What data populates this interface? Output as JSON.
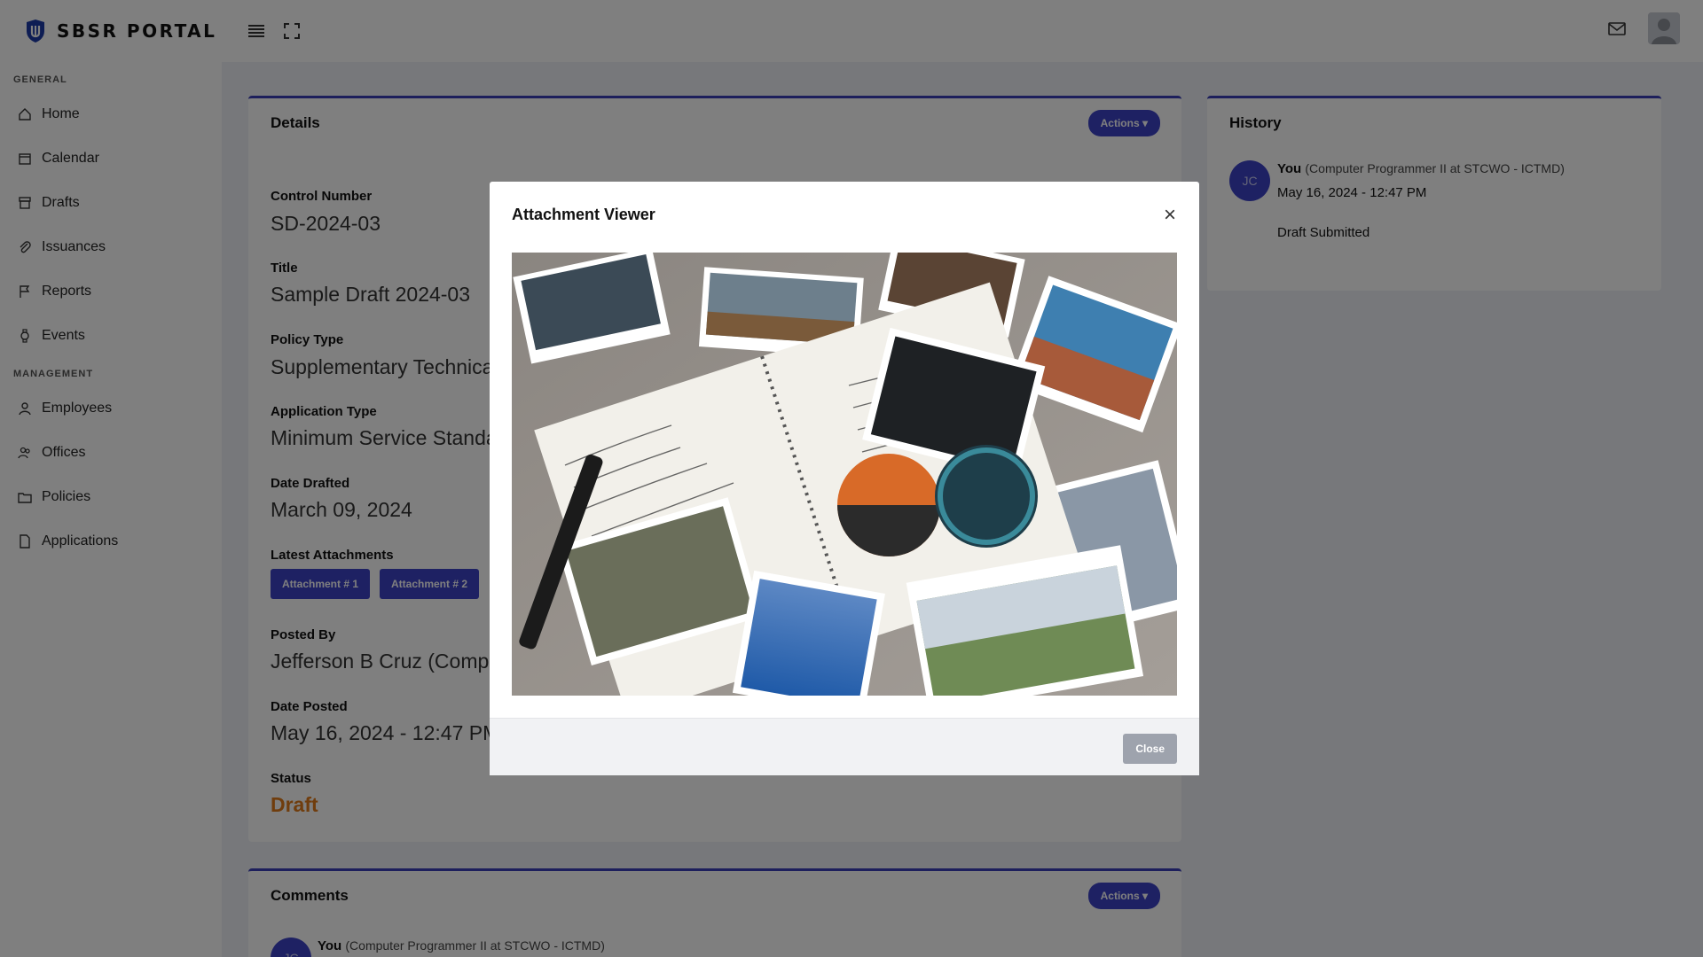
{
  "app": {
    "name": "SBSR PORTAL"
  },
  "sidebar": {
    "general_label": "GENERAL",
    "management_label": "MANAGEMENT",
    "general_items": [
      {
        "label": "Home",
        "icon": "home-icon"
      },
      {
        "label": "Calendar",
        "icon": "calendar-icon"
      },
      {
        "label": "Drafts",
        "icon": "drafts-icon"
      },
      {
        "label": "Issuances",
        "icon": "paperclip-icon"
      },
      {
        "label": "Reports",
        "icon": "flag-icon"
      },
      {
        "label": "Events",
        "icon": "watch-icon"
      }
    ],
    "management_items": [
      {
        "label": "Employees",
        "icon": "person-icon"
      },
      {
        "label": "Offices",
        "icon": "people-icon"
      },
      {
        "label": "Policies",
        "icon": "folder-icon"
      },
      {
        "label": "Applications",
        "icon": "file-icon"
      }
    ]
  },
  "details": {
    "title": "Details",
    "actions_label": "Actions ▾",
    "control_number_label": "Control Number",
    "control_number": "SD-2024-03",
    "title_label": "Title",
    "title_value": "Sample Draft 2024-03",
    "policy_type_label": "Policy Type",
    "policy_type": "Supplementary Technical",
    "application_type_label": "Application Type",
    "application_type": "Minimum Service Standa",
    "date_drafted_label": "Date Drafted",
    "date_drafted": "March 09, 2024",
    "attachments_label": "Latest Attachments",
    "attachments": [
      "Attachment # 1",
      "Attachment # 2"
    ],
    "posted_by_label": "Posted By",
    "posted_by": "Jefferson B Cruz (Compu",
    "date_posted_label": "Date Posted",
    "date_posted": "May 16, 2024 - 12:47 PM",
    "status_label": "Status",
    "status": "Draft",
    "status_color": "#e07b1a"
  },
  "history": {
    "title": "History",
    "avatar_initials": "JC",
    "user": "You",
    "role": "(Computer Programmer II at STCWO - ICTMD)",
    "timestamp": "May 16, 2024 - 12:47 PM",
    "action": "Draft Submitted"
  },
  "comments": {
    "title": "Comments",
    "actions_label": "Actions ▾",
    "avatar_initials": "JC",
    "user": "You",
    "role": "(Computer Programmer II at STCWO - ICTMD)"
  },
  "modal": {
    "title": "Attachment Viewer",
    "close_x": "×",
    "close_label": "Close"
  },
  "colors": {
    "accent": "#3d42c6",
    "draft": "#e07b1a"
  }
}
